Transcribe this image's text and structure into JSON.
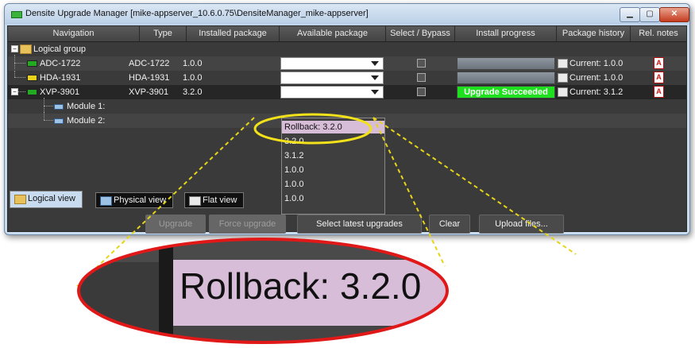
{
  "window": {
    "title": "Densite Upgrade Manager [mike-appserver_10.6.0.75\\DensiteManager_mike-appserver]",
    "controls": {
      "minimize": "▁",
      "maximize": "▢",
      "close": "✕"
    }
  },
  "table": {
    "columns": [
      "Navigation",
      "Type",
      "Installed package",
      "Available package",
      "Select / Bypass",
      "Install progress",
      "Package history",
      "Rel. notes"
    ],
    "group_label": "Logical group",
    "rows": [
      {
        "name": "ADC-1722",
        "type": "ADC-1722",
        "installed": "1.0.0",
        "progress": "",
        "history": "Current: 1.0.0",
        "status_color": "#22aa22"
      },
      {
        "name": "HDA-1931",
        "type": "HDA-1931",
        "installed": "1.0.0",
        "progress": "",
        "history": "Current: 1.0.0",
        "status_color": "#e8d21a"
      },
      {
        "name": "XVP-3901",
        "type": "XVP-3901",
        "installed": "3.2.0",
        "progress": "Upgrade Succeeded",
        "history": "Current: 3.1.2",
        "status_color": "#22aa22"
      }
    ],
    "modules": [
      "Module 1:",
      "Module 2:"
    ]
  },
  "dropdown": {
    "options": [
      "Rollback: 3.2.0",
      "3.2.0",
      "3.1.2",
      "1.0.0",
      "1.0.0",
      "1.0.0"
    ],
    "selected_index": 0,
    "highlight_color": "#d8bdd8"
  },
  "tabs": [
    "Logical view",
    "Physical view",
    "Flat view"
  ],
  "buttons": {
    "upgrade": "Upgrade",
    "force_upgrade": "Force upgrade",
    "select_latest": "Select latest upgrades",
    "clear": "Clear",
    "upload": "Upload files..."
  },
  "callout": {
    "zoom_text": "Rollback: 3.2.0",
    "ellipse_color": "#e01818",
    "small_ellipse_color": "#f3e21a",
    "connector_color": "#e6d418"
  },
  "pdf_label": "A"
}
